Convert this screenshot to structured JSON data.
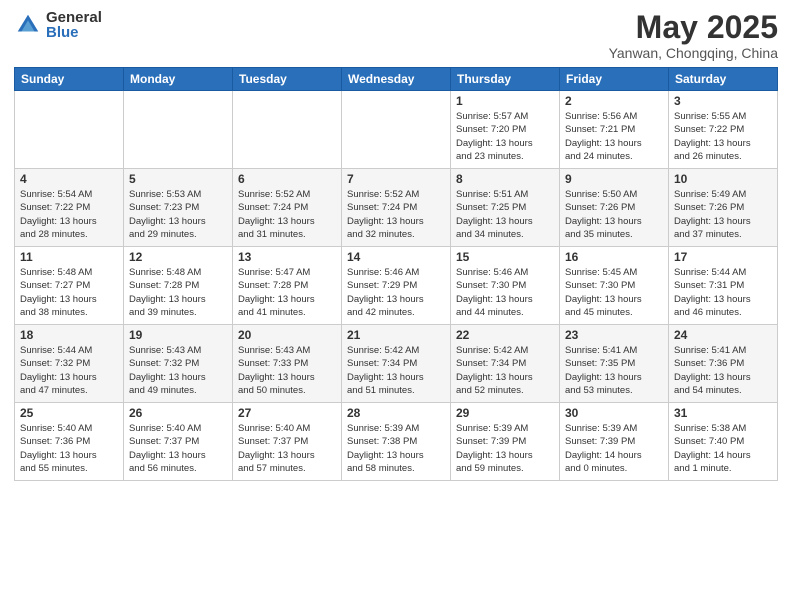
{
  "logo": {
    "general": "General",
    "blue": "Blue"
  },
  "title": "May 2025",
  "location": "Yanwan, Chongqing, China",
  "weekdays": [
    "Sunday",
    "Monday",
    "Tuesday",
    "Wednesday",
    "Thursday",
    "Friday",
    "Saturday"
  ],
  "weeks": [
    [
      {
        "day": "",
        "info": ""
      },
      {
        "day": "",
        "info": ""
      },
      {
        "day": "",
        "info": ""
      },
      {
        "day": "",
        "info": ""
      },
      {
        "day": "1",
        "info": "Sunrise: 5:57 AM\nSunset: 7:20 PM\nDaylight: 13 hours\nand 23 minutes."
      },
      {
        "day": "2",
        "info": "Sunrise: 5:56 AM\nSunset: 7:21 PM\nDaylight: 13 hours\nand 24 minutes."
      },
      {
        "day": "3",
        "info": "Sunrise: 5:55 AM\nSunset: 7:22 PM\nDaylight: 13 hours\nand 26 minutes."
      }
    ],
    [
      {
        "day": "4",
        "info": "Sunrise: 5:54 AM\nSunset: 7:22 PM\nDaylight: 13 hours\nand 28 minutes."
      },
      {
        "day": "5",
        "info": "Sunrise: 5:53 AM\nSunset: 7:23 PM\nDaylight: 13 hours\nand 29 minutes."
      },
      {
        "day": "6",
        "info": "Sunrise: 5:52 AM\nSunset: 7:24 PM\nDaylight: 13 hours\nand 31 minutes."
      },
      {
        "day": "7",
        "info": "Sunrise: 5:52 AM\nSunset: 7:24 PM\nDaylight: 13 hours\nand 32 minutes."
      },
      {
        "day": "8",
        "info": "Sunrise: 5:51 AM\nSunset: 7:25 PM\nDaylight: 13 hours\nand 34 minutes."
      },
      {
        "day": "9",
        "info": "Sunrise: 5:50 AM\nSunset: 7:26 PM\nDaylight: 13 hours\nand 35 minutes."
      },
      {
        "day": "10",
        "info": "Sunrise: 5:49 AM\nSunset: 7:26 PM\nDaylight: 13 hours\nand 37 minutes."
      }
    ],
    [
      {
        "day": "11",
        "info": "Sunrise: 5:48 AM\nSunset: 7:27 PM\nDaylight: 13 hours\nand 38 minutes."
      },
      {
        "day": "12",
        "info": "Sunrise: 5:48 AM\nSunset: 7:28 PM\nDaylight: 13 hours\nand 39 minutes."
      },
      {
        "day": "13",
        "info": "Sunrise: 5:47 AM\nSunset: 7:28 PM\nDaylight: 13 hours\nand 41 minutes."
      },
      {
        "day": "14",
        "info": "Sunrise: 5:46 AM\nSunset: 7:29 PM\nDaylight: 13 hours\nand 42 minutes."
      },
      {
        "day": "15",
        "info": "Sunrise: 5:46 AM\nSunset: 7:30 PM\nDaylight: 13 hours\nand 44 minutes."
      },
      {
        "day": "16",
        "info": "Sunrise: 5:45 AM\nSunset: 7:30 PM\nDaylight: 13 hours\nand 45 minutes."
      },
      {
        "day": "17",
        "info": "Sunrise: 5:44 AM\nSunset: 7:31 PM\nDaylight: 13 hours\nand 46 minutes."
      }
    ],
    [
      {
        "day": "18",
        "info": "Sunrise: 5:44 AM\nSunset: 7:32 PM\nDaylight: 13 hours\nand 47 minutes."
      },
      {
        "day": "19",
        "info": "Sunrise: 5:43 AM\nSunset: 7:32 PM\nDaylight: 13 hours\nand 49 minutes."
      },
      {
        "day": "20",
        "info": "Sunrise: 5:43 AM\nSunset: 7:33 PM\nDaylight: 13 hours\nand 50 minutes."
      },
      {
        "day": "21",
        "info": "Sunrise: 5:42 AM\nSunset: 7:34 PM\nDaylight: 13 hours\nand 51 minutes."
      },
      {
        "day": "22",
        "info": "Sunrise: 5:42 AM\nSunset: 7:34 PM\nDaylight: 13 hours\nand 52 minutes."
      },
      {
        "day": "23",
        "info": "Sunrise: 5:41 AM\nSunset: 7:35 PM\nDaylight: 13 hours\nand 53 minutes."
      },
      {
        "day": "24",
        "info": "Sunrise: 5:41 AM\nSunset: 7:36 PM\nDaylight: 13 hours\nand 54 minutes."
      }
    ],
    [
      {
        "day": "25",
        "info": "Sunrise: 5:40 AM\nSunset: 7:36 PM\nDaylight: 13 hours\nand 55 minutes."
      },
      {
        "day": "26",
        "info": "Sunrise: 5:40 AM\nSunset: 7:37 PM\nDaylight: 13 hours\nand 56 minutes."
      },
      {
        "day": "27",
        "info": "Sunrise: 5:40 AM\nSunset: 7:37 PM\nDaylight: 13 hours\nand 57 minutes."
      },
      {
        "day": "28",
        "info": "Sunrise: 5:39 AM\nSunset: 7:38 PM\nDaylight: 13 hours\nand 58 minutes."
      },
      {
        "day": "29",
        "info": "Sunrise: 5:39 AM\nSunset: 7:39 PM\nDaylight: 13 hours\nand 59 minutes."
      },
      {
        "day": "30",
        "info": "Sunrise: 5:39 AM\nSunset: 7:39 PM\nDaylight: 14 hours\nand 0 minutes."
      },
      {
        "day": "31",
        "info": "Sunrise: 5:38 AM\nSunset: 7:40 PM\nDaylight: 14 hours\nand 1 minute."
      }
    ]
  ]
}
